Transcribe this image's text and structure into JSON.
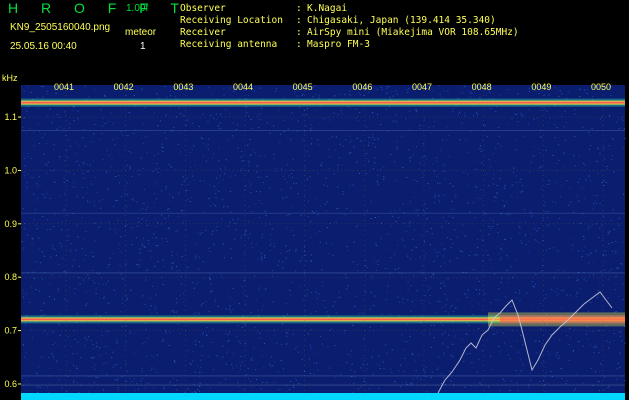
{
  "header": {
    "app_name": "H R O F F T",
    "version": "1.00f",
    "filename": "KN9_2505160040.png",
    "meteors_label": "meteor",
    "datetime": "25.05.16 00:40",
    "meteors_count": "1"
  },
  "metadata": [
    {
      "key": "Observer",
      "value": "K.Nagai"
    },
    {
      "key": "Receiving Location",
      "value": "Chigasaki, Japan (139.414 35.340)"
    },
    {
      "key": "Receiver",
      "value": "AirSpy mini (Miakejima VOR 108.65MHz)"
    },
    {
      "key": "Receiving antenna",
      "value": "Maspro FM-3"
    }
  ],
  "spectrogram": {
    "y_unit": "kHz",
    "y_ticks": [
      "1.1",
      "1.0",
      "0.9",
      "0.8",
      "0.7",
      "0.6"
    ],
    "y_range_khz": [
      0.57,
      1.16
    ],
    "x_ticks": [
      "0041",
      "0042",
      "0043",
      "0044",
      "0045",
      "0046",
      "0047",
      "0048",
      "0049",
      "0050"
    ],
    "carrier_lines_khz": [
      1.127,
      0.721
    ],
    "colors": {
      "background": "#0a1d6e",
      "noise": "#2a64c8",
      "grid": "#8a6a30",
      "tick_label": "#ffff55",
      "hot": "#ff5050",
      "warm": "#ffff40",
      "cool": "#40ffb0",
      "baseline": "#00d8ff"
    }
  }
}
